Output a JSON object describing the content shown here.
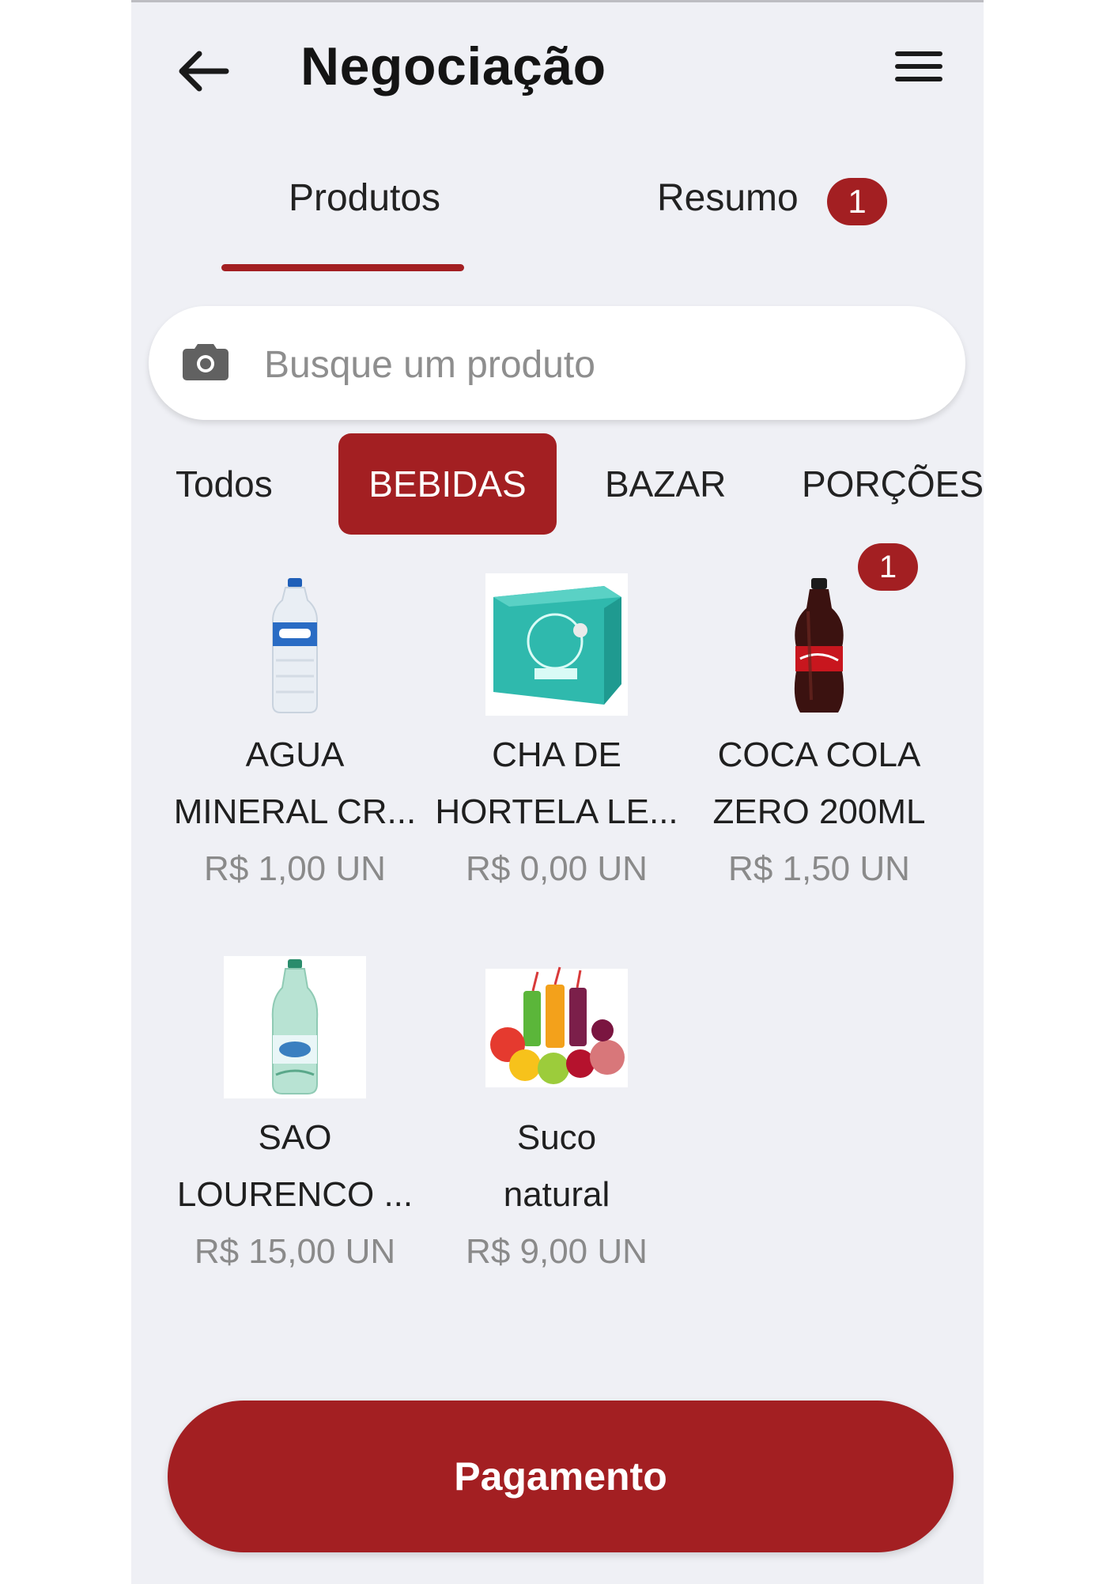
{
  "header": {
    "title": "Negociação"
  },
  "tabs": [
    {
      "label": "Produtos",
      "active": true
    },
    {
      "label": "Resumo",
      "badge": "1"
    }
  ],
  "search": {
    "placeholder": "Busque um produto",
    "value": ""
  },
  "categories": [
    {
      "label": "Todos",
      "active": false
    },
    {
      "label": "BEBIDAS",
      "active": true
    },
    {
      "label": "BAZAR",
      "active": false
    },
    {
      "label": "PORÇÕES",
      "active": false
    }
  ],
  "products": [
    {
      "name_line1": "AGUA",
      "name_line2": "MINERAL CR...",
      "price": "R$ 1,00 UN",
      "image": "water-bottle"
    },
    {
      "name_line1": "CHA DE",
      "name_line2": "HORTELA LE...",
      "price": "R$ 0,00 UN",
      "image": "tea-box"
    },
    {
      "name_line1": "COCA COLA",
      "name_line2": "ZERO 200ML",
      "price": "R$ 1,50 UN",
      "image": "cola-bottle",
      "badge": "1"
    },
    {
      "name_line1": "SAO",
      "name_line2": "LOURENCO ...",
      "price": "R$ 15,00 UN",
      "image": "green-water-bottle"
    },
    {
      "name_line1": "Suco",
      "name_line2": "natural",
      "price": "R$ 9,00 UN",
      "image": "juice-fruits"
    }
  ],
  "footer": {
    "pay_label": "Pagamento"
  },
  "colors": {
    "accent": "#a31f22",
    "background": "#eff0f5"
  }
}
